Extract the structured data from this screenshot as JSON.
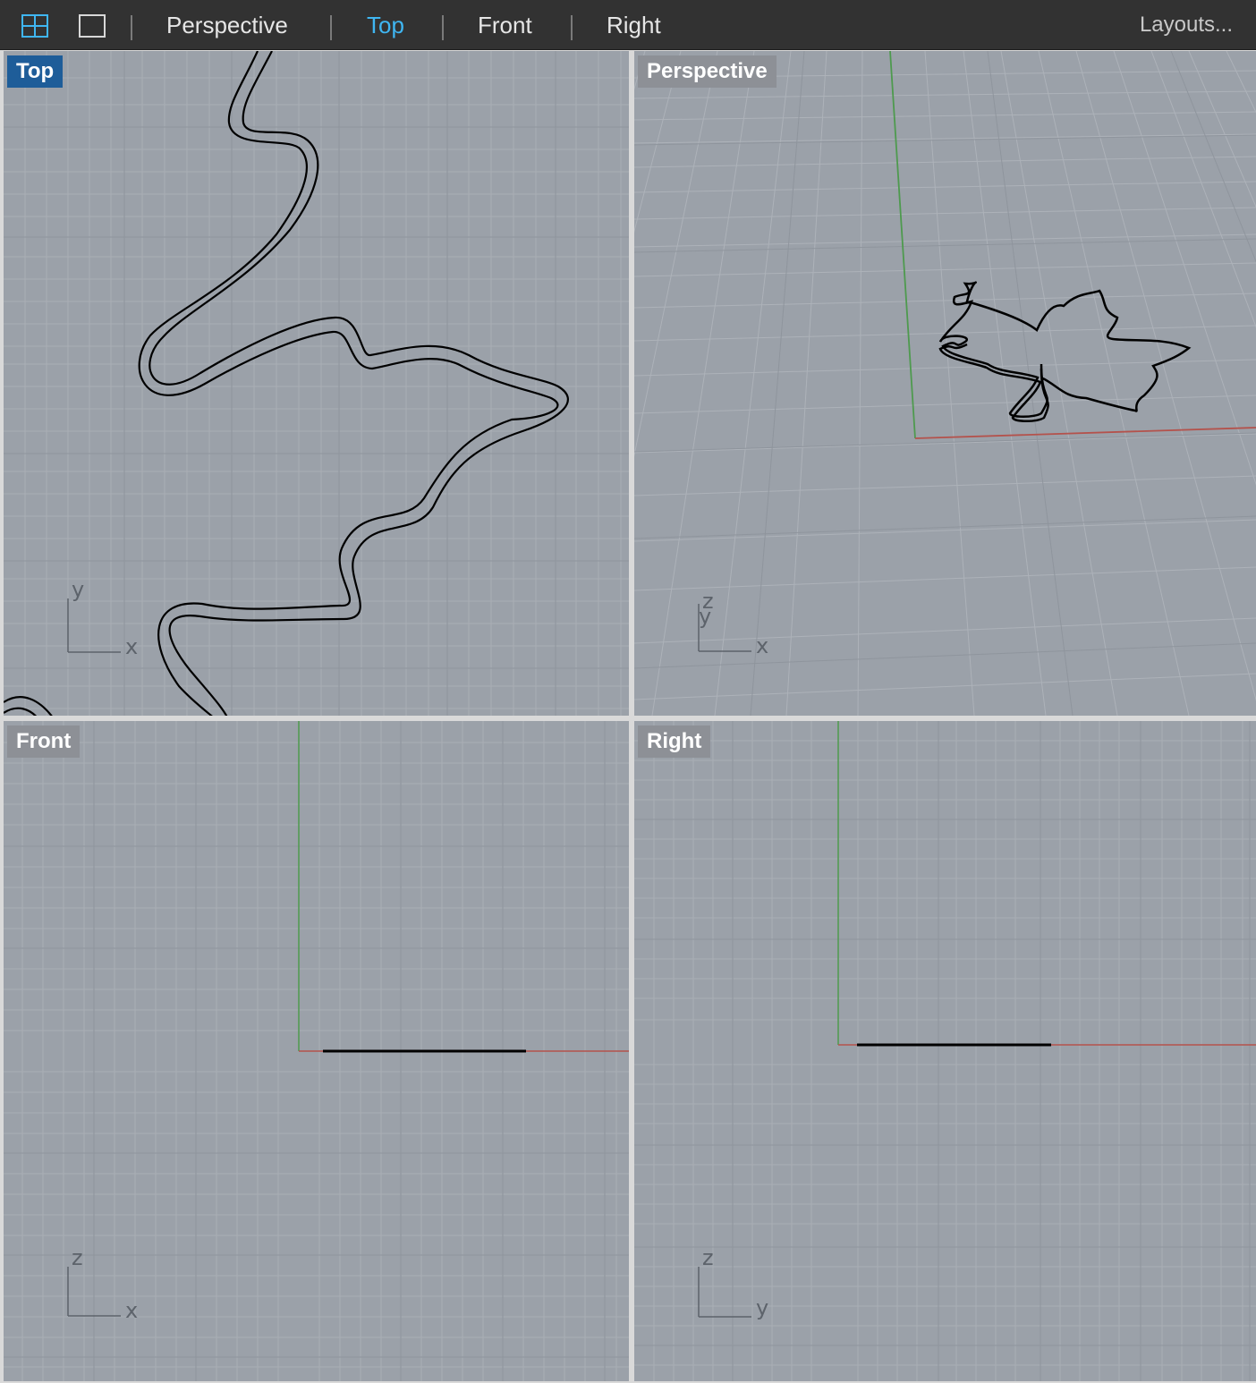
{
  "toolbar": {
    "tabs": [
      {
        "label": "Perspective",
        "active": false
      },
      {
        "label": "Top",
        "active": true
      },
      {
        "label": "Front",
        "active": false
      },
      {
        "label": "Right",
        "active": false
      }
    ],
    "layouts_label": "Layouts...",
    "icons": [
      "four-viewports-icon",
      "single-viewport-icon"
    ]
  },
  "viewports": {
    "top": {
      "label": "Top",
      "active": true,
      "axis_labels": [
        "y",
        "x"
      ]
    },
    "perspective": {
      "label": "Perspective",
      "active": false,
      "axis_labels": [
        "z",
        "y",
        "x"
      ]
    },
    "front": {
      "label": "Front",
      "active": false,
      "axis_labels": [
        "z",
        "x"
      ]
    },
    "right": {
      "label": "Right",
      "active": false,
      "axis_labels": [
        "z",
        "y"
      ]
    }
  },
  "colors": {
    "toolbar_bg": "#323232",
    "active_tab": "#3fb6f2",
    "viewport_bg": "#9ba1a9",
    "active_label_bg": "#1e5d99",
    "x_axis": "#b4524c",
    "y_axis": "#4e9a4e"
  }
}
